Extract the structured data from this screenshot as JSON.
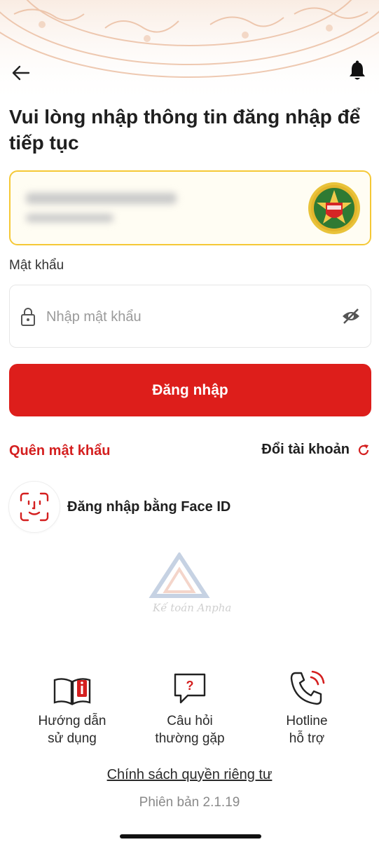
{
  "header": {
    "back_icon": "back-arrow-icon",
    "bell_icon": "bell-icon"
  },
  "title": "Vui lòng nhập thông tin đăng nhập để tiếp tục",
  "account": {
    "avatar_icon": "vneid-badge-icon"
  },
  "password": {
    "label": "Mật khẩu",
    "placeholder": "Nhập mật khẩu",
    "value": "",
    "lock_icon": "lock-icon",
    "toggle_icon": "eye-hidden-icon"
  },
  "login_button": "Đăng nhập",
  "forgot_password": "Quên mật khẩu",
  "switch_account": "Đổi tài khoản",
  "face_id": "Đăng nhập bằng Face ID",
  "support": [
    {
      "icon": "book-info-icon",
      "line1": "Hướng dẫn",
      "line2": "sử dụng"
    },
    {
      "icon": "question-bubble-icon",
      "line1": "Câu hỏi",
      "line2": "thường gặp"
    },
    {
      "icon": "phone-call-icon",
      "line1": "Hotline",
      "line2": "hỗ trợ"
    }
  ],
  "privacy": "Chính sách quyền riêng tư",
  "version": "Phiên bản 2.1.19",
  "colors": {
    "primary": "#dd1e1b",
    "accent_border": "#f5c836"
  }
}
